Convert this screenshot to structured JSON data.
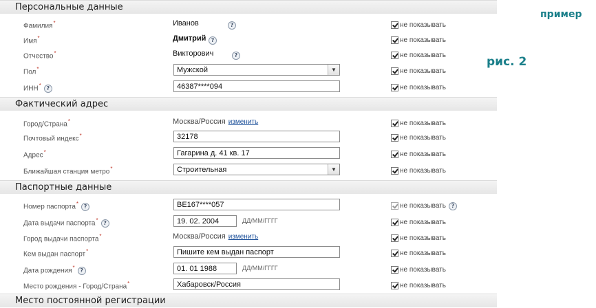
{
  "notes": {
    "example": "пример",
    "figure": "рис. 2"
  },
  "sections": {
    "personal": "Персональные данные",
    "address": "Фактический адрес",
    "passport": "Паспортные данные",
    "registration": "Место постоянной регистрации"
  },
  "hide_label": "не показывать",
  "change_link": "изменить",
  "date_hint": "ДД/ММ/ГГГГ",
  "personal": {
    "lastname_label": "Фамилия",
    "lastname_value": "Иванов",
    "firstname_label": "Имя",
    "firstname_value": "Дмитрий",
    "patronymic_label": "Отчество",
    "patronymic_value": "Викторович",
    "gender_label": "Пол",
    "gender_value": "Мужской",
    "inn_label": "ИНН",
    "inn_value": "46387****094"
  },
  "address": {
    "city_label": "Город/Страна",
    "city_value": "Москва/Россия",
    "zip_label": "Почтовый индекс",
    "zip_value": "32178",
    "street_label": "Адрес",
    "street_value": "Гагарина д. 41 кв. 17",
    "metro_label": "Ближайшая станция метро",
    "metro_value": "Строительная"
  },
  "passport": {
    "number_label": "Номер паспорта",
    "number_value": "BE167****057",
    "issue_date_label": "Дата выдачи паспорта",
    "issue_date_value": "19. 02. 2004",
    "issue_city_label": "Город выдачи паспорта",
    "issue_city_value": "Москва/Россия",
    "issued_by_label": "Кем выдан паспорт",
    "issued_by_value": "Пишите кем выдан паспорт",
    "birth_date_label": "Дата рождения",
    "birth_date_value": "01. 01 1988",
    "birth_place_label": "Место рождения - Город/Страна",
    "birth_place_value": "Хабаровск/Россия"
  }
}
